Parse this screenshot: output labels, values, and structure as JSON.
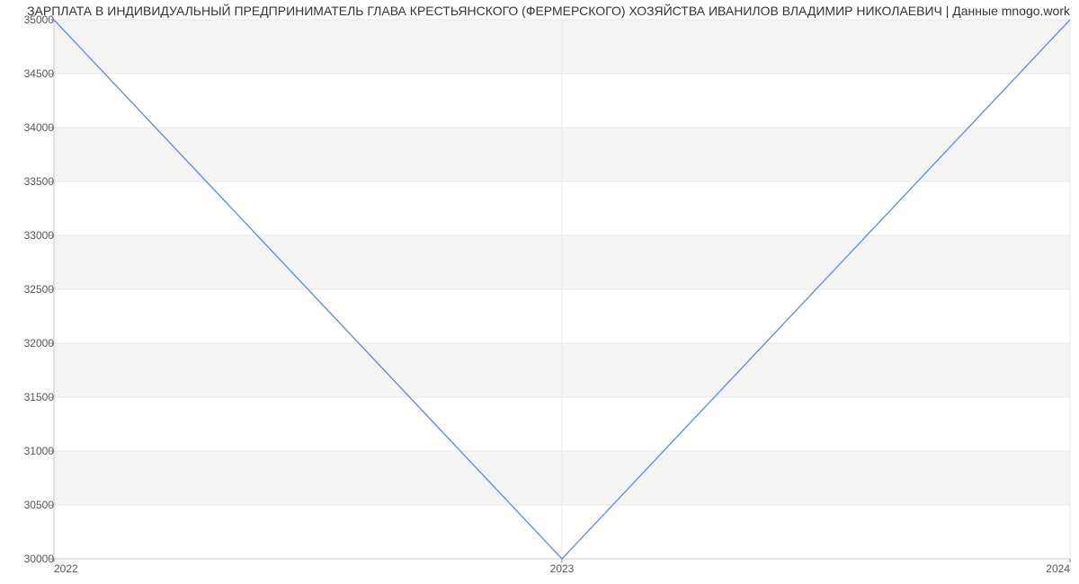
{
  "chart_data": {
    "type": "line",
    "title": "ЗАРПЛАТА В ИНДИВИДУАЛЬНЫЙ ПРЕДПРИНИМАТЕЛЬ ГЛАВА КРЕСТЬЯНСКОГО (ФЕРМЕРСКОГО) ХОЗЯЙСТВА ИВАНИЛОВ ВЛАДИМИР НИКОЛАЕВИЧ | Данные mnogo.work",
    "x": [
      2022,
      2023,
      2024
    ],
    "values": [
      35000,
      30000,
      35000
    ],
    "x_ticks": [
      2022,
      2023,
      2024
    ],
    "y_ticks": [
      30000,
      30500,
      31000,
      31500,
      32000,
      32500,
      33000,
      33500,
      34000,
      34500,
      35000
    ],
    "xlim": [
      2022,
      2024
    ],
    "ylim": [
      30000,
      35000
    ],
    "line_color": "#6b8ecf",
    "band_color": "#f4f4f4"
  }
}
